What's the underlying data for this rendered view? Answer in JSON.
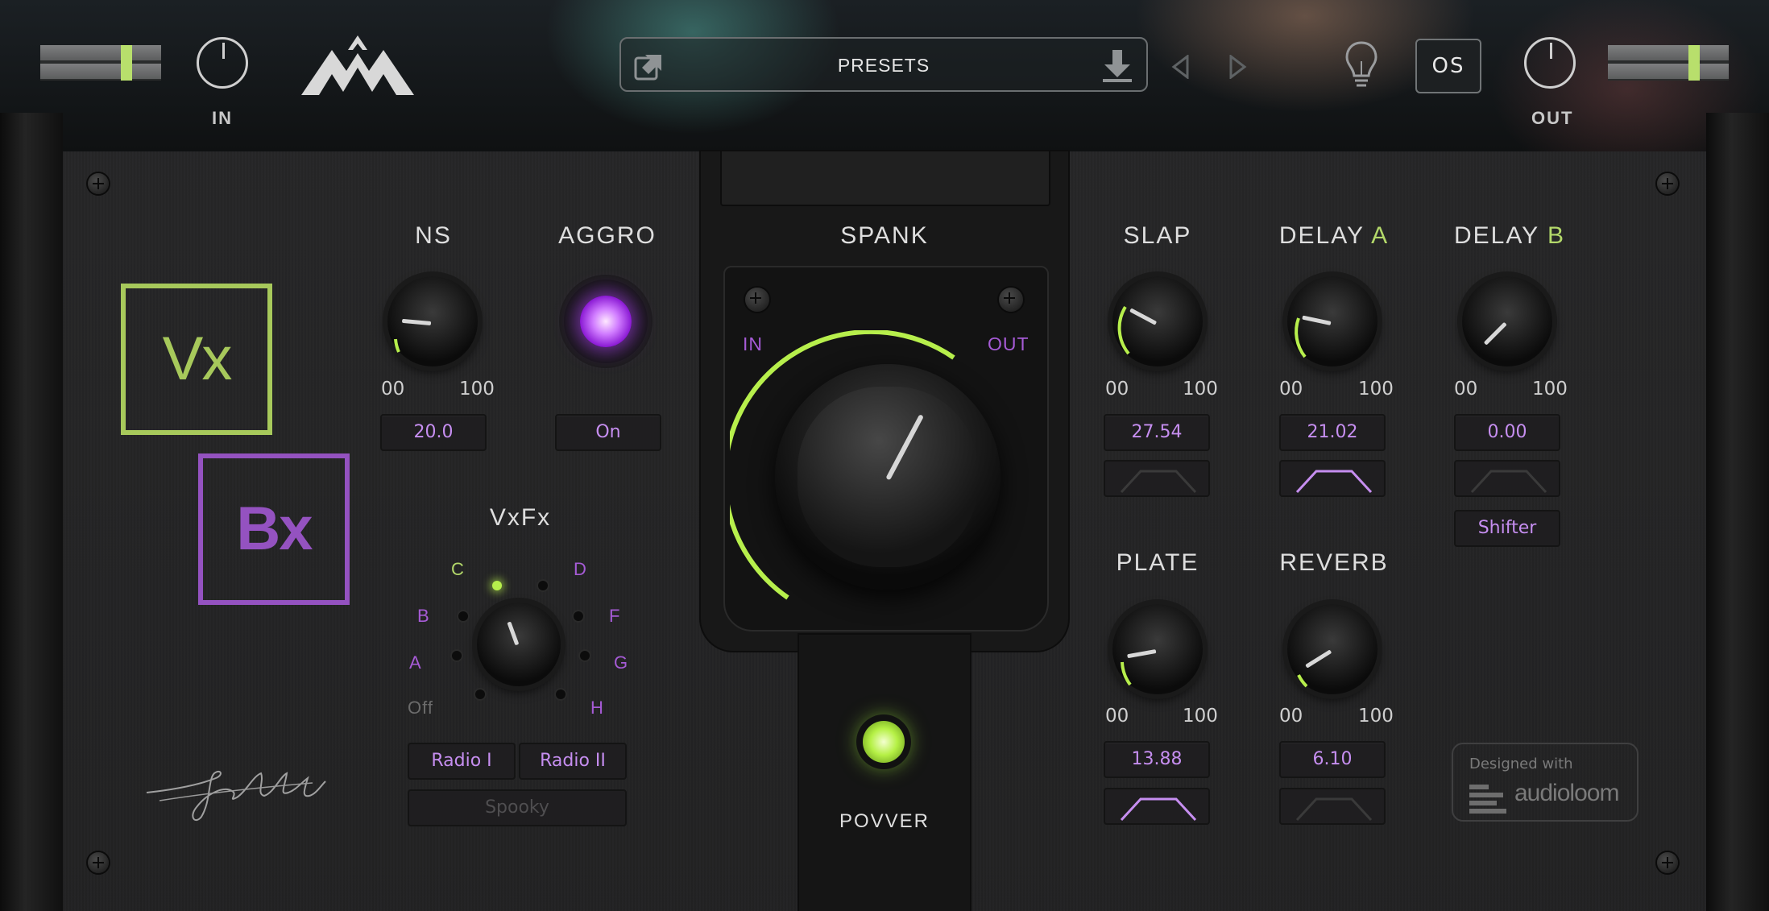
{
  "header": {
    "input_label": "IN",
    "output_label": "OUT",
    "presets_label": "PRESETS",
    "os_label": "OS",
    "icons": [
      "export-icon",
      "download-icon",
      "prev-arrow-icon",
      "next-arrow-icon",
      "lightbulb-icon",
      "logo-icon"
    ]
  },
  "brand": {
    "vx": "Vx",
    "bx": "Bx"
  },
  "ns": {
    "title": "NS",
    "min": "00",
    "max": "100",
    "value": "20.0"
  },
  "aggro": {
    "title": "AGGRO",
    "value": "On"
  },
  "vxfx": {
    "title": "VxFx",
    "positions": [
      "Off",
      "A",
      "B",
      "C",
      "D",
      "F",
      "G",
      "H"
    ],
    "selected": "C",
    "buttons": {
      "radio1": "Radio I",
      "radio2": "Radio II",
      "spooky": "Spooky"
    }
  },
  "spank": {
    "title": "SPANK",
    "in": "IN",
    "out": "OUT"
  },
  "power": {
    "label": "POVVER"
  },
  "slap": {
    "title": "SLAP",
    "min": "00",
    "max": "100",
    "value": "27.54"
  },
  "delay_a": {
    "title": "DELAY",
    "suffix": "A",
    "min": "00",
    "max": "100",
    "value": "21.02"
  },
  "delay_b": {
    "title": "DELAY",
    "suffix": "B",
    "min": "00",
    "max": "100",
    "value": "0.00",
    "shifter": "Shifter"
  },
  "plate": {
    "title": "PLATE",
    "min": "00",
    "max": "100",
    "value": "13.88"
  },
  "reverb": {
    "title": "REVERB",
    "min": "00",
    "max": "100",
    "value": "6.10"
  },
  "footer": {
    "designed_with": "Designed with",
    "audioloom": "audioloom",
    "signature": "John Maciel"
  },
  "colors": {
    "green": "#b3d86a",
    "purple": "#c68ef0",
    "panel": "#242425"
  }
}
